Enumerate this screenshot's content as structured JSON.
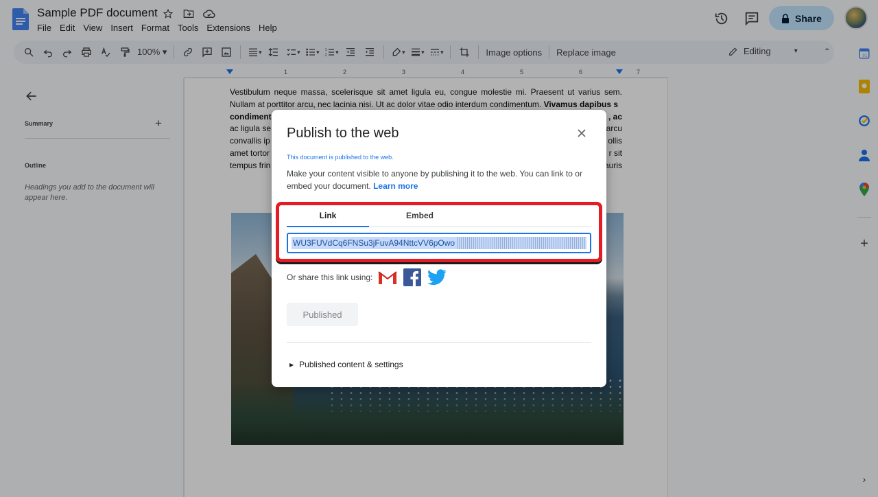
{
  "app": {
    "doc_title": "Sample PDF document",
    "menu": [
      "File",
      "Edit",
      "View",
      "Insert",
      "Format",
      "Tools",
      "Extensions",
      "Help"
    ],
    "share_label": "Share"
  },
  "toolbar": {
    "zoom": "100%",
    "image_options": "Image options",
    "replace_image": "Replace image",
    "mode": "Editing"
  },
  "ruler": {
    "numbers": [
      "1",
      "1",
      "2",
      "3",
      "4",
      "5",
      "6",
      "7"
    ]
  },
  "outline_panel": {
    "summary_label": "Summary",
    "outline_label": "Outline",
    "outline_hint": "Headings you add to the document will appear here."
  },
  "document": {
    "paragraph_visible": "Vestibulum neque massa, scelerisque sit amet ligula eu, congue molestie mi. Praesent ut varius sem. Nullam at porttitor arcu, nec lacinia nisi. Ut ac dolor vitae odio interdum condimentum.",
    "bold_fragment": "Vivamus dapibus s",
    "line_3": "condiment",
    "line_4": "ac ligula se",
    "line_5": "convallis ip",
    "line_6": "amet tortor",
    "line_7": "tempus frin",
    "right_frag_3": ", ac",
    "right_frag_4": "arcu",
    "right_frag_5": "ollis",
    "right_frag_6": "r sit",
    "right_frag_7": "auris"
  },
  "dialog": {
    "title": "Publish to the web",
    "status": "This document is published to the web.",
    "description": "Make your content visible to anyone by publishing it to the web. You can link to or embed your document.",
    "learn_more": "Learn more",
    "tabs": [
      {
        "label": "Link",
        "active": true
      },
      {
        "label": "Embed",
        "active": false
      }
    ],
    "url_value": "WU3FUVdCq6FNSu3jFuvA94NttcVV6pOwo",
    "share_prompt": "Or share this link using:",
    "published_button": "Published",
    "settings_toggle": "Published content & settings"
  },
  "colors": {
    "accent": "#1a73e8",
    "highlight": "#e31c25",
    "share_button_bg": "#c2e7ff"
  },
  "icons": {
    "share_options": [
      "gmail-icon",
      "facebook-icon",
      "twitter-icon"
    ]
  }
}
